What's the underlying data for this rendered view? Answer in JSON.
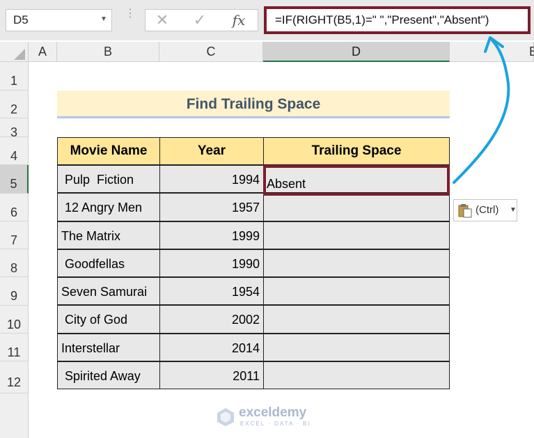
{
  "formula_bar": {
    "name_box": "D5",
    "name_box_dropdown_icon": "chevron-down-icon",
    "cancel_icon": "close-icon",
    "enter_icon": "check-icon",
    "fx_label": "fx",
    "formula": "=IF(RIGHT(B5,1)=\" \",\"Present\",\"Absent\")"
  },
  "columns": [
    "A",
    "B",
    "C",
    "D",
    "E"
  ],
  "selected_column": "D",
  "rows": [
    "1",
    "2",
    "3",
    "4",
    "5",
    "6",
    "7",
    "8",
    "9",
    "10",
    "11",
    "12"
  ],
  "selected_row": "5",
  "title": "Find Trailing Space",
  "table": {
    "headers": [
      "Movie Name",
      "Year",
      "Trailing Space"
    ],
    "rows": [
      {
        "name": " Pulp  Fiction",
        "year": "1994",
        "result": "Absent"
      },
      {
        "name": " 12 Angry Men",
        "year": "1957",
        "result": ""
      },
      {
        "name": "The Matrix",
        "year": "1999",
        "result": ""
      },
      {
        "name": " Goodfellas",
        "year": "1990",
        "result": ""
      },
      {
        "name": "Seven Samurai",
        "year": "1954",
        "result": ""
      },
      {
        "name": " City of God",
        "year": "2002",
        "result": ""
      },
      {
        "name": "Interstellar",
        "year": "2014",
        "result": ""
      },
      {
        "name": " Spirited Away",
        "year": "2011",
        "result": ""
      }
    ]
  },
  "paste_options": {
    "label": "(Ctrl)",
    "icon": "clipboard-icon"
  },
  "watermark": {
    "name": "exceldemy",
    "tagline": "EXCEL · DATA · BI"
  },
  "colors": {
    "highlight_border": "#7b1d2c",
    "arrow": "#1aa3e0",
    "header_fill": "#ffe699",
    "title_fill": "#fff2cc",
    "cell_fill": "#e8e8e8"
  }
}
